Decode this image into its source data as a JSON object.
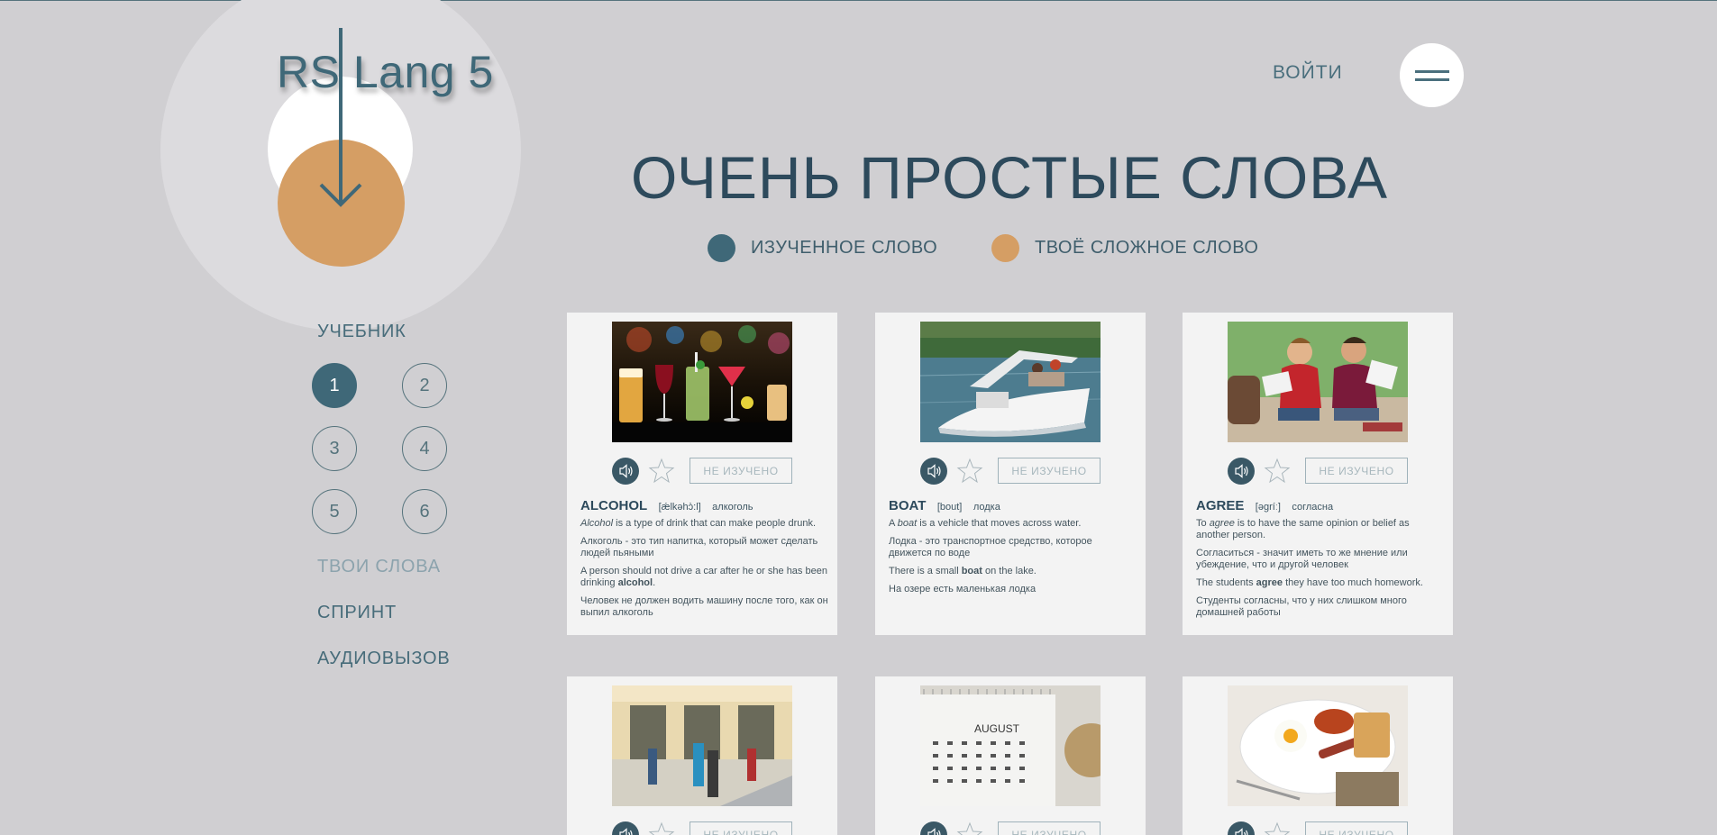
{
  "logo": {
    "text": "RS Lang 5"
  },
  "header": {
    "login_label": "ВОЙТИ"
  },
  "page_title": "ОЧЕНЬ ПРОСТЫЕ СЛОВА",
  "legend": {
    "learned": {
      "label": "ИЗУЧЕННОЕ СЛОВО",
      "color": "#3f6878"
    },
    "hard": {
      "label": "ТВОЁ СЛОЖНОЕ СЛОВО",
      "color": "#d59e64"
    }
  },
  "sidebar": {
    "textbook_label": "УЧЕБНИК",
    "levels": [
      "1",
      "2",
      "3",
      "4",
      "5",
      "6"
    ],
    "active_level": "1",
    "my_words_label": "ТВОИ СЛОВА",
    "sprint_label": "СПРИНТ",
    "audiocall_label": "АУДИОВЫЗОВ"
  },
  "cards": [
    {
      "word": "ALCOHOL",
      "transcription": "[ǽlkəhɔ̀:l]",
      "translation": "алкоголь",
      "status": "НЕ ИЗУЧЕНО",
      "meaning_pre": "",
      "meaning_em": "Alcohol",
      "meaning_post": " is a type of drink that can make people drunk.",
      "meaning_ru": "Алкоголь - это тип напитка, который может сделать людей пьяными",
      "example_pre": "A person should not drive a car after he or she has been drinking ",
      "example_b": "alcohol",
      "example_post": ".",
      "example_ru": "Человек не должен водить машину после того, как он выпил алкоголь"
    },
    {
      "word": "BOAT",
      "transcription": "[bout]",
      "translation": "лодка",
      "status": "НЕ ИЗУЧЕНО",
      "meaning_pre": "A ",
      "meaning_em": "boat",
      "meaning_post": " is a vehicle that moves across water.",
      "meaning_ru": "Лодка - это транспортное средство, которое движется по воде",
      "example_pre": "There is a small ",
      "example_b": "boat",
      "example_post": " on the lake.",
      "example_ru": "На озере есть маленькая лодка"
    },
    {
      "word": "AGREE",
      "transcription": "[əgríː]",
      "translation": "согласна",
      "status": "НЕ ИЗУЧЕНО",
      "meaning_pre": "To ",
      "meaning_em": "agree",
      "meaning_post": " is to have the same opinion or belief as another person.",
      "meaning_ru": "Согласиться - значит иметь то же мнение или убеждение, что и другой человек",
      "example_pre": "The students ",
      "example_b": "agree",
      "example_post": " they have too much homework.",
      "example_ru": "Студенты согласны, что у них слишком много домашней работы"
    },
    {
      "status": "НЕ ИЗУЧЕНО"
    },
    {
      "status": "НЕ ИЗУЧЕНО",
      "calendar_month": "AUGUST"
    },
    {
      "status": "НЕ ИЗУЧЕНО"
    }
  ],
  "icons": {
    "audio": "speaker-icon",
    "star": "star-outline-icon",
    "menu": "hamburger-icon",
    "logo_arrow": "arrow-down-icon"
  }
}
